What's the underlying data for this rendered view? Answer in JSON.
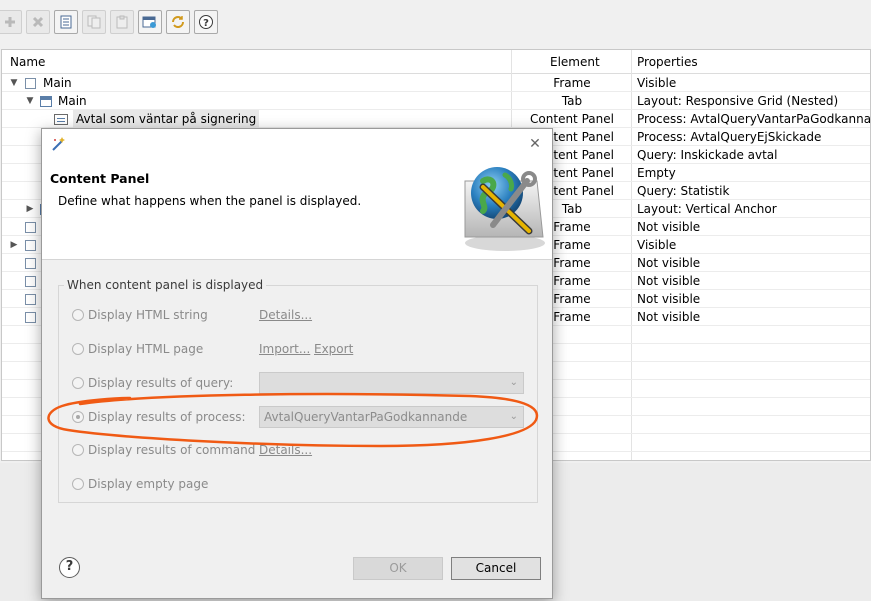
{
  "toolbar": {
    "buttons": [
      {
        "icon": "add-icon"
      },
      {
        "icon": "delete-icon"
      },
      {
        "icon": "properties-icon"
      },
      {
        "icon": "copy-icon"
      },
      {
        "icon": "paste-icon"
      },
      {
        "icon": "preview-icon"
      },
      {
        "icon": "refresh-icon"
      },
      {
        "icon": "help-icon"
      }
    ]
  },
  "tree": {
    "headers": {
      "name": "Name",
      "element": "Element",
      "properties": "Properties"
    },
    "rows": [
      {
        "name": "Main",
        "element": "Frame",
        "properties": "Visible"
      },
      {
        "name": "Main",
        "element": "Tab",
        "properties": "Layout: Responsive Grid (Nested)"
      },
      {
        "name": "Avtal som väntar på signering",
        "element": "Content Panel",
        "properties": "Process: AvtalQueryVantarPaGodkannande"
      },
      {
        "name": "",
        "element": "Content Panel",
        "properties": "Process: AvtalQueryEjSkickade"
      },
      {
        "name": "",
        "element": "Content Panel",
        "properties": "Query: Inskickade avtal"
      },
      {
        "name": "",
        "element": "Content Panel",
        "properties": "Empty"
      },
      {
        "name": "",
        "element": "Content Panel",
        "properties": "Query: Statistik"
      },
      {
        "name": "",
        "element": "Tab",
        "properties": "Layout: Vertical Anchor"
      },
      {
        "name": "",
        "element": "Frame",
        "properties": "Not visible"
      },
      {
        "name": "",
        "element": "Frame",
        "properties": "Visible"
      },
      {
        "name": "",
        "element": "Frame",
        "properties": "Not visible"
      },
      {
        "name": "",
        "element": "Frame",
        "properties": "Not visible"
      },
      {
        "name": "",
        "element": "Frame",
        "properties": "Not visible"
      },
      {
        "name": "",
        "element": "Frame",
        "properties": "Not visible"
      }
    ]
  },
  "dialog": {
    "title": "Content Panel",
    "description": "Define what happens when the panel is displayed.",
    "close_glyph": "✕",
    "group_label": "When content panel is displayed",
    "options": {
      "html_string": "Display HTML string",
      "html_page": "Display HTML page",
      "query": "Display results of query:",
      "process": "Display results of process:",
      "command": "Display results of command",
      "empty": "Display empty page"
    },
    "links": {
      "details_html": "Details...",
      "import": "Import...",
      "export": "Export",
      "details_command": "Details..."
    },
    "query_value": "",
    "process_value": "AvtalQueryVantarPaGodkannande",
    "selected_option": "process",
    "help_glyph": "?",
    "ok_label": "OK",
    "cancel_label": "Cancel"
  },
  "colors": {
    "highlight": "#f05a14",
    "link": "#8a8a8a",
    "disabled_text": "#8a8a8a"
  }
}
